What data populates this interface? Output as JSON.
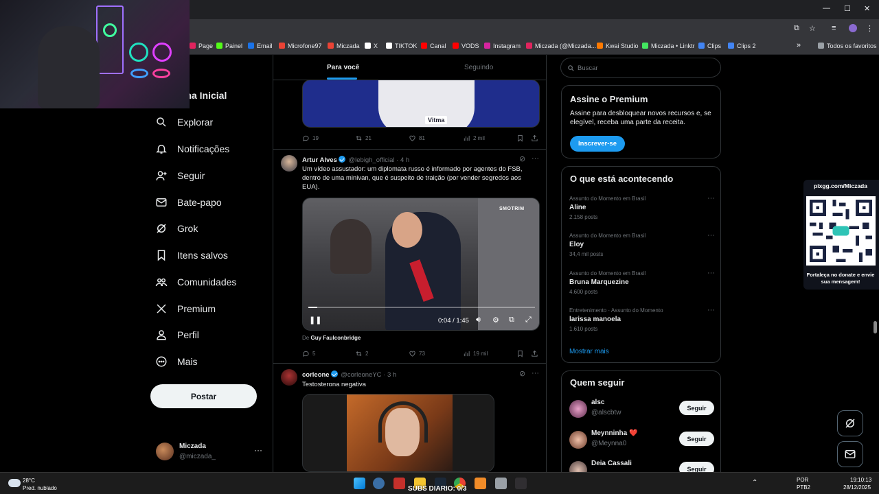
{
  "browser": {
    "window_controls": {
      "minimize": "—",
      "maximize": "☐",
      "close": "✕"
    },
    "bookmarks": [
      {
        "label": "Page",
        "color": "#e0245e"
      },
      {
        "label": "Painel",
        "color": "#53fc18"
      },
      {
        "label": "Email",
        "color": "#1a73e8"
      },
      {
        "label": "Microfone97",
        "color": "#ea4335"
      },
      {
        "label": "Miczada",
        "color": "#ea4335"
      },
      {
        "label": "X",
        "color": "#ffffff"
      },
      {
        "label": "TIKTOK",
        "color": "#ffffff"
      },
      {
        "label": "Canal",
        "color": "#ff0000"
      },
      {
        "label": "VODS",
        "color": "#ff0000"
      },
      {
        "label": "Instagram",
        "color": "#d6249f"
      },
      {
        "label": "Miczada (@Miczada...",
        "color": "#e0245e"
      },
      {
        "label": "Kwai Studio",
        "color": "#ff7a00"
      },
      {
        "label": "Miczada • Linktr",
        "color": "#43e660"
      },
      {
        "label": "Clips",
        "color": "#4285f4"
      },
      {
        "label": "Clips 2",
        "color": "#4285f4"
      }
    ],
    "overflow_label": "»",
    "all_favorites": "Todos os favoritos"
  },
  "sidebar": {
    "home": "gina Inicial",
    "items": [
      {
        "label": "Explorar",
        "icon": "search-icon"
      },
      {
        "label": "Notificações",
        "icon": "bell-icon"
      },
      {
        "label": "Seguir",
        "icon": "follow-icon"
      },
      {
        "label": "Bate-papo",
        "icon": "mail-icon"
      },
      {
        "label": "Grok",
        "icon": "grok-icon"
      },
      {
        "label": "Itens salvos",
        "icon": "bookmark-icon"
      },
      {
        "label": "Comunidades",
        "icon": "communities-icon"
      },
      {
        "label": "Premium",
        "icon": "x-icon"
      },
      {
        "label": "Perfil",
        "icon": "profile-icon"
      },
      {
        "label": "Mais",
        "icon": "more-icon"
      }
    ],
    "post_button": "Postar",
    "account": {
      "name": "Miczada",
      "handle": "@miczada_",
      "more": "···"
    }
  },
  "feed": {
    "tabs": {
      "active": "Para você",
      "inactive": "Seguindo"
    },
    "tweet1": {
      "media_badge": "Vitma",
      "replies": "19",
      "reposts": "21",
      "likes": "81",
      "views": "2 mil"
    },
    "tweet2": {
      "name": "Artur Alves",
      "handle": "@lebigh_official · 4 h",
      "text": "Um vídeo assustador: um diplomata russo é informado por agentes do FSB, dentro de uma minivan, que é suspeito de traição (por vender segredos aos EUA).",
      "watermark": "SMOTRIM",
      "video_time": "0:04 / 1:45",
      "video_progress": 0.04,
      "credit_prefix": "De",
      "credit_name": "Guy Faulconbridge",
      "replies": "5",
      "reposts": "2",
      "likes": "73",
      "views": "19 mil"
    },
    "tweet3": {
      "name": "corleone",
      "handle": "@corleoneYC · 3 h",
      "text": "Testosterona negativa"
    }
  },
  "right": {
    "search_placeholder": "Buscar",
    "premium": {
      "title": "Assine o Premium",
      "desc": "Assine para desbloquear novos recursos e, se elegível, receba uma parte da receita.",
      "button": "Inscrever-se"
    },
    "trends": {
      "title": "O que está acontecendo",
      "items": [
        {
          "ctx": "Assunto do Momento em Brasil",
          "title": "Aline",
          "count": "2.158 posts"
        },
        {
          "ctx": "Assunto do Momento em Brasil",
          "title": "Eloy",
          "count": "34,4 mil posts"
        },
        {
          "ctx": "Assunto do Momento em Brasil",
          "title": "Bruna Marquezine",
          "count": "4.600 posts"
        },
        {
          "ctx": "Entretenimento · Assunto do Momento",
          "title": "larissa manoela",
          "count": "1.610 posts"
        }
      ],
      "more": "Mostrar mais"
    },
    "follow": {
      "title": "Quem seguir",
      "button": "Seguir",
      "users": [
        {
          "name": "alsc",
          "handle": "@alscbtw"
        },
        {
          "name": "Meynninha ❤️",
          "handle": "@Meynna0"
        },
        {
          "name": "Deia Cassali",
          "handle": ""
        }
      ]
    }
  },
  "overlay": {
    "qr_top": "pixgg.com/Miczada",
    "qr_bottom": "Fortaleça no donate e envie sua mensagem!",
    "subs": "SUBS DIARIO: 0/3"
  },
  "taskbar": {
    "temp": "28°C",
    "condition": "Pred. nublado",
    "lang1": "POR",
    "lang2": "PTB2",
    "time": "19:10:13",
    "date": "28/12/2025"
  }
}
